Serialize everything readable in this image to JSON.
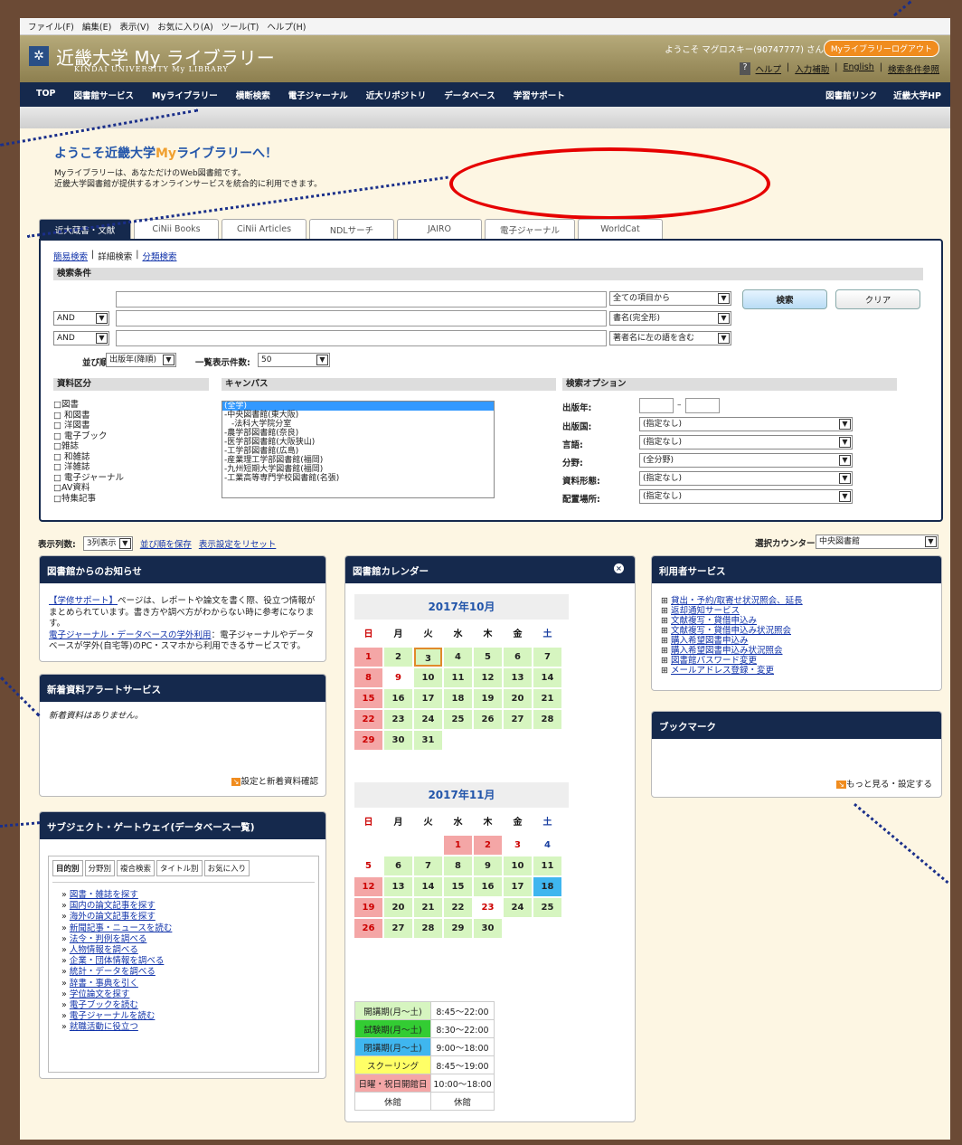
{
  "menubar": [
    "ファイル(F)",
    "編集(E)",
    "表示(V)",
    "お気に入り(A)",
    "ツール(T)",
    "ヘルプ(H)"
  ],
  "banner": {
    "title": "近畿大学 My ライブラリー",
    "subtitle": "KINDAI UNIVERSITY My LIBRARY",
    "welcome": "ようこそ マグロスキー(90747777) さん",
    "logout": "Myライブラリーログアウト",
    "help": "ヘルプ",
    "input_help": "入力補助",
    "english": "English",
    "search_ref": "検索条件参照"
  },
  "nav": {
    "left": [
      "TOP",
      "図書館サービス",
      "Myライブラリー",
      "横断検索",
      "電子ジャーナル",
      "近大リポジトリ",
      "データベース",
      "学習サポート"
    ],
    "right": [
      "図書館リンク",
      "近畿大学HP"
    ]
  },
  "intro": {
    "title_a": "ようこそ近畿大学",
    "title_my": "My",
    "title_b": "ライブラリーへ！",
    "line1": "Myライブラリーは、あなただけのWeb図書館です。",
    "line2": "近畿大学図書館が提供するオンラインサービスを統合的に利用できます。"
  },
  "tabs": [
    "近大蔵書・文献",
    "CiNii Books",
    "CiNii Articles",
    "NDLサーチ",
    "JAIRO",
    "電子ジャーナル",
    "WorldCat"
  ],
  "search": {
    "mode_simple": "簡易検索",
    "mode_detail": "詳細検索",
    "mode_class": "分類検索",
    "criteria_header": "検索条件",
    "and1": "AND",
    "and2": "AND",
    "field1": "全ての項目から",
    "field2": "書名(完全形)",
    "field3": "著者名に左の語を含む",
    "search_btn": "検索",
    "clear_btn": "クリア",
    "sort_label": "並び順:",
    "sort_value": "出版年(降順)",
    "count_label": "一覧表示件数:",
    "count_value": "50",
    "material_header": "資料区分",
    "campus_header": "キャンパス",
    "option_header": "検索オプション",
    "materials": [
      "□図書",
      "□ 和図書",
      "□ 洋図書",
      "□ 電子ブック",
      "□雑誌",
      "□ 和雑誌",
      "□ 洋雑誌",
      "□ 電子ジャーナル",
      "□AV資料",
      "□特集記事"
    ],
    "campuses": [
      "(全学)",
      "-中央図書館(東大阪)",
      "  -法科大学院分室",
      "-農学部図書館(奈良)",
      "-医学部図書館(大阪狭山)",
      "-工学部図書館(広島)",
      "-産業理工学部図書館(福岡)",
      "-九州短期大学図書館(福岡)",
      "-工業高等専門学校図書館(名張)"
    ],
    "opt_year": "出版年:",
    "opt_country": "出版国:",
    "opt_lang": "言語:",
    "opt_field": "分野:",
    "opt_form": "資料形態:",
    "opt_place": "配置場所:",
    "year_dash": "–",
    "val_country": "(指定なし)",
    "val_lang": "(指定なし)",
    "val_field": "(全分野)",
    "val_form": "(指定なし)",
    "val_place": "(指定なし)"
  },
  "display": {
    "cols_label": "表示列数:",
    "cols_value": "3列表示",
    "save_order": "並び順を保存",
    "reset": "表示設定をリセット",
    "counter_label": "選択カウンター:",
    "counter_value": "中央図書館"
  },
  "news": {
    "title": "図書館からのお知らせ",
    "link1": "【学修サポート】",
    "text1": "ページは、レポートや論文を書く際、役立つ情報がまとめられています。書き方や調べ方がわからない時に参考になります。",
    "link2": "電子ジャーナル・データベースの学外利用",
    "text2": "：電子ジャーナルやデータベースが学外(自宅等)のPC・スマホから利用できるサービスです。"
  },
  "alert": {
    "title": "新着資料アラートサービス",
    "empty": "新着資料はありません。",
    "setting": "設定と新着資料確認"
  },
  "gateway": {
    "title": "サブジェクト・ゲートウェイ(データベース一覧)",
    "tabs": [
      "目的別",
      "分野別",
      "複合検索",
      "タイトル別",
      "お気に入り"
    ],
    "items": [
      "図書・雑誌を探す",
      "国内の論文記事を探す",
      "海外の論文記事を探す",
      "新聞記事・ニュースを読む",
      "法令・判例を調べる",
      "人物情報を調べる",
      "企業・団体情報を調べる",
      "統計・データを調べる",
      "辞書・事典を引く",
      "学位論文を探す",
      "電子ブックを読む",
      "電子ジャーナルを読む",
      "就職活動に役立つ"
    ]
  },
  "calendar": {
    "title": "図書館カレンダー",
    "weekdays": [
      "日",
      "月",
      "火",
      "水",
      "木",
      "金",
      "土"
    ],
    "oct": {
      "label": "2017年10月",
      "cells": [
        [
          "1",
          "pink"
        ],
        [
          "2",
          "green"
        ],
        [
          "3",
          "green today"
        ],
        [
          "4",
          "green"
        ],
        [
          "5",
          "green"
        ],
        [
          "6",
          "green"
        ],
        [
          "7",
          "green"
        ],
        [
          "8",
          "pink"
        ],
        [
          "9",
          "red"
        ],
        [
          "10",
          "green"
        ],
        [
          "11",
          "green"
        ],
        [
          "12",
          "green"
        ],
        [
          "13",
          "green"
        ],
        [
          "14",
          "green"
        ],
        [
          "15",
          "pink"
        ],
        [
          "16",
          "green"
        ],
        [
          "17",
          "green"
        ],
        [
          "18",
          "green"
        ],
        [
          "19",
          "green"
        ],
        [
          "20",
          "green"
        ],
        [
          "21",
          "green"
        ],
        [
          "22",
          "pink"
        ],
        [
          "23",
          "green"
        ],
        [
          "24",
          "green"
        ],
        [
          "25",
          "green"
        ],
        [
          "26",
          "green"
        ],
        [
          "27",
          "green"
        ],
        [
          "28",
          "green"
        ],
        [
          "29",
          "pink"
        ],
        [
          "30",
          "green"
        ],
        [
          "31",
          "green"
        ]
      ]
    },
    "nov": {
      "label": "2017年11月",
      "cells": [
        [
          "",
          ""
        ],
        [
          "",
          ""
        ],
        [
          "",
          ""
        ],
        [
          "1",
          "pink"
        ],
        [
          "2",
          "pink"
        ],
        [
          "3",
          "red"
        ],
        [
          "4",
          "sat"
        ],
        [
          "5",
          "red"
        ],
        [
          "6",
          "green"
        ],
        [
          "7",
          "green"
        ],
        [
          "8",
          "green"
        ],
        [
          "9",
          "green"
        ],
        [
          "10",
          "green"
        ],
        [
          "11",
          "green"
        ],
        [
          "12",
          "pink"
        ],
        [
          "13",
          "green"
        ],
        [
          "14",
          "green"
        ],
        [
          "15",
          "green"
        ],
        [
          "16",
          "green"
        ],
        [
          "17",
          "green"
        ],
        [
          "18",
          "blue"
        ],
        [
          "19",
          "pink"
        ],
        [
          "20",
          "green"
        ],
        [
          "21",
          "green"
        ],
        [
          "22",
          "green"
        ],
        [
          "23",
          "red"
        ],
        [
          "24",
          "green"
        ],
        [
          "25",
          "green"
        ],
        [
          "26",
          "pink"
        ],
        [
          "27",
          "green"
        ],
        [
          "28",
          "green"
        ],
        [
          "29",
          "green"
        ],
        [
          "30",
          "green"
        ]
      ]
    },
    "hours": [
      [
        "開講期(月〜土)",
        "8:45〜22:00",
        "#d6f5c0"
      ],
      [
        "試験期(月〜土)",
        "8:30〜22:00",
        "#33cc33"
      ],
      [
        "閉講期(月〜土)",
        "9:00〜18:00",
        "#3fb6ef"
      ],
      [
        "スクーリング",
        "8:45〜19:00",
        "#ffff66"
      ],
      [
        "日曜・祝日開館日",
        "10:00〜18:00",
        "#f4a6a6"
      ],
      [
        "休館",
        "休館",
        "#ffffff"
      ]
    ]
  },
  "user_service": {
    "title": "利用者サービス",
    "items": [
      "貸出・予約/取寄せ状況照会、延長",
      "返却通知サービス",
      "文献複写・貸借申込み",
      "文献複写・貸借申込み状況照会",
      "購入希望図書申込み",
      "購入希望図書申込み状況照会",
      "図書館パスワード変更",
      "メールアドレス登録・変更"
    ]
  },
  "bookmark": {
    "title": "ブックマーク",
    "more": "もっと見る・設定する"
  },
  "colors": {
    "navy": "#15294d",
    "accent_orange": "#f08c1e",
    "annotation_red": "#e60000",
    "annotation_dots": "#1a2f8a"
  }
}
